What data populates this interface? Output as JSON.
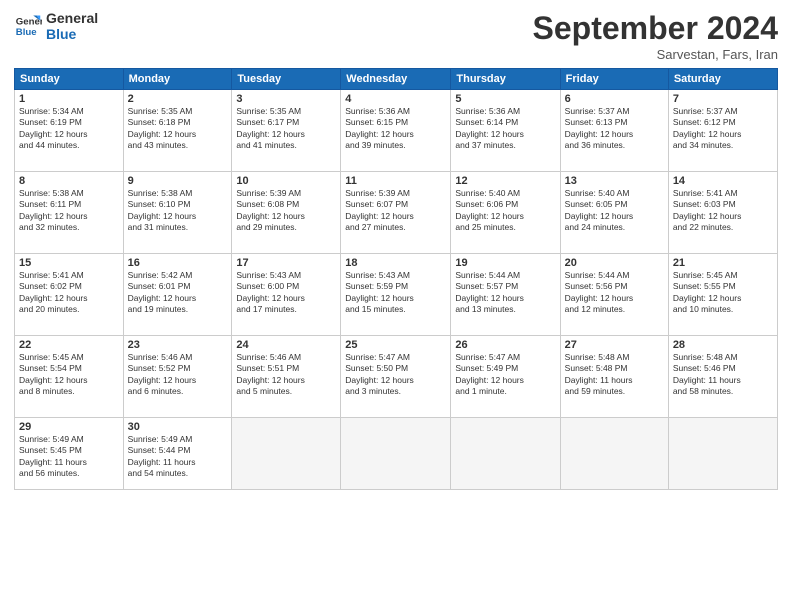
{
  "logo": {
    "line1": "General",
    "line2": "Blue"
  },
  "title": "September 2024",
  "location": "Sarvestan, Fars, Iran",
  "weekdays": [
    "Sunday",
    "Monday",
    "Tuesday",
    "Wednesday",
    "Thursday",
    "Friday",
    "Saturday"
  ],
  "weeks": [
    [
      {
        "day": "1",
        "info": "Sunrise: 5:34 AM\nSunset: 6:19 PM\nDaylight: 12 hours\nand 44 minutes."
      },
      {
        "day": "2",
        "info": "Sunrise: 5:35 AM\nSunset: 6:18 PM\nDaylight: 12 hours\nand 43 minutes."
      },
      {
        "day": "3",
        "info": "Sunrise: 5:35 AM\nSunset: 6:17 PM\nDaylight: 12 hours\nand 41 minutes."
      },
      {
        "day": "4",
        "info": "Sunrise: 5:36 AM\nSunset: 6:15 PM\nDaylight: 12 hours\nand 39 minutes."
      },
      {
        "day": "5",
        "info": "Sunrise: 5:36 AM\nSunset: 6:14 PM\nDaylight: 12 hours\nand 37 minutes."
      },
      {
        "day": "6",
        "info": "Sunrise: 5:37 AM\nSunset: 6:13 PM\nDaylight: 12 hours\nand 36 minutes."
      },
      {
        "day": "7",
        "info": "Sunrise: 5:37 AM\nSunset: 6:12 PM\nDaylight: 12 hours\nand 34 minutes."
      }
    ],
    [
      {
        "day": "8",
        "info": "Sunrise: 5:38 AM\nSunset: 6:11 PM\nDaylight: 12 hours\nand 32 minutes."
      },
      {
        "day": "9",
        "info": "Sunrise: 5:38 AM\nSunset: 6:10 PM\nDaylight: 12 hours\nand 31 minutes."
      },
      {
        "day": "10",
        "info": "Sunrise: 5:39 AM\nSunset: 6:08 PM\nDaylight: 12 hours\nand 29 minutes."
      },
      {
        "day": "11",
        "info": "Sunrise: 5:39 AM\nSunset: 6:07 PM\nDaylight: 12 hours\nand 27 minutes."
      },
      {
        "day": "12",
        "info": "Sunrise: 5:40 AM\nSunset: 6:06 PM\nDaylight: 12 hours\nand 25 minutes."
      },
      {
        "day": "13",
        "info": "Sunrise: 5:40 AM\nSunset: 6:05 PM\nDaylight: 12 hours\nand 24 minutes."
      },
      {
        "day": "14",
        "info": "Sunrise: 5:41 AM\nSunset: 6:03 PM\nDaylight: 12 hours\nand 22 minutes."
      }
    ],
    [
      {
        "day": "15",
        "info": "Sunrise: 5:41 AM\nSunset: 6:02 PM\nDaylight: 12 hours\nand 20 minutes."
      },
      {
        "day": "16",
        "info": "Sunrise: 5:42 AM\nSunset: 6:01 PM\nDaylight: 12 hours\nand 19 minutes."
      },
      {
        "day": "17",
        "info": "Sunrise: 5:43 AM\nSunset: 6:00 PM\nDaylight: 12 hours\nand 17 minutes."
      },
      {
        "day": "18",
        "info": "Sunrise: 5:43 AM\nSunset: 5:59 PM\nDaylight: 12 hours\nand 15 minutes."
      },
      {
        "day": "19",
        "info": "Sunrise: 5:44 AM\nSunset: 5:57 PM\nDaylight: 12 hours\nand 13 minutes."
      },
      {
        "day": "20",
        "info": "Sunrise: 5:44 AM\nSunset: 5:56 PM\nDaylight: 12 hours\nand 12 minutes."
      },
      {
        "day": "21",
        "info": "Sunrise: 5:45 AM\nSunset: 5:55 PM\nDaylight: 12 hours\nand 10 minutes."
      }
    ],
    [
      {
        "day": "22",
        "info": "Sunrise: 5:45 AM\nSunset: 5:54 PM\nDaylight: 12 hours\nand 8 minutes."
      },
      {
        "day": "23",
        "info": "Sunrise: 5:46 AM\nSunset: 5:52 PM\nDaylight: 12 hours\nand 6 minutes."
      },
      {
        "day": "24",
        "info": "Sunrise: 5:46 AM\nSunset: 5:51 PM\nDaylight: 12 hours\nand 5 minutes."
      },
      {
        "day": "25",
        "info": "Sunrise: 5:47 AM\nSunset: 5:50 PM\nDaylight: 12 hours\nand 3 minutes."
      },
      {
        "day": "26",
        "info": "Sunrise: 5:47 AM\nSunset: 5:49 PM\nDaylight: 12 hours\nand 1 minute."
      },
      {
        "day": "27",
        "info": "Sunrise: 5:48 AM\nSunset: 5:48 PM\nDaylight: 11 hours\nand 59 minutes."
      },
      {
        "day": "28",
        "info": "Sunrise: 5:48 AM\nSunset: 5:46 PM\nDaylight: 11 hours\nand 58 minutes."
      }
    ],
    [
      {
        "day": "29",
        "info": "Sunrise: 5:49 AM\nSunset: 5:45 PM\nDaylight: 11 hours\nand 56 minutes."
      },
      {
        "day": "30",
        "info": "Sunrise: 5:49 AM\nSunset: 5:44 PM\nDaylight: 11 hours\nand 54 minutes."
      },
      {
        "day": "",
        "info": ""
      },
      {
        "day": "",
        "info": ""
      },
      {
        "day": "",
        "info": ""
      },
      {
        "day": "",
        "info": ""
      },
      {
        "day": "",
        "info": ""
      }
    ]
  ]
}
